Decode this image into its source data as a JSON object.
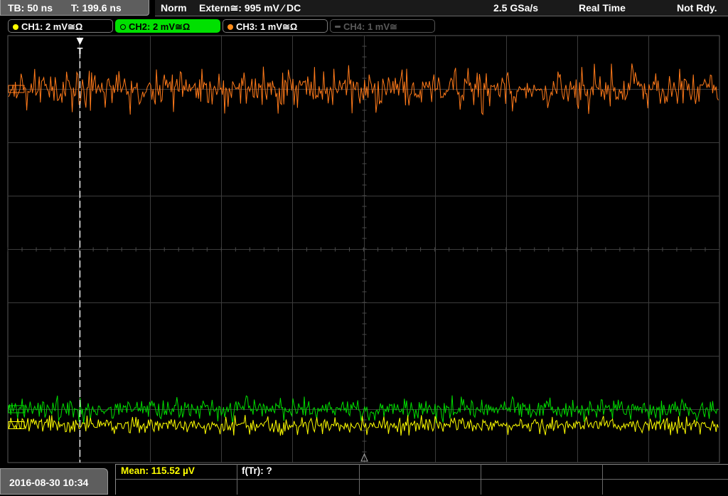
{
  "top_bar": {
    "timebase": "TB: 50 ns",
    "trigger_time": "T: 199.6 ns",
    "trigger_mode": "Norm",
    "trigger_source": "Extern≅: 995 mV ⁄ DC",
    "sample_rate": "2.5 GSa/s",
    "acquisition_mode": "Real Time",
    "status": "Not Rdy."
  },
  "channels": [
    {
      "label": "CH1: 2 mV≅Ω",
      "color": "#ffff00",
      "state": "on"
    },
    {
      "label": "CH2: 2 mV≅Ω",
      "color": "#00e000",
      "state": "selected"
    },
    {
      "label": "CH3: 1 mV≅Ω",
      "color": "#ff8c1a",
      "state": "on"
    },
    {
      "label": "CH4: 1 mV≅",
      "color": "#5a5a5a",
      "state": "off"
    }
  ],
  "trigger_marker": "T",
  "traces": [
    {
      "channel": "CH3",
      "color": "#ff7a1a",
      "level_div": 1.0,
      "noise_div": 0.32
    },
    {
      "channel": "CH2",
      "color": "#00dd00",
      "level_div": 7.0,
      "noise_div": 0.18
    },
    {
      "channel": "CH1",
      "color": "#ffff00",
      "level_div": 7.3,
      "noise_div": 0.13
    }
  ],
  "bottom_bar": {
    "datetime": "2016-08-30 10:34",
    "measurement_mean": "Mean: 115.52 µV",
    "measurement_freq": "f(Tr): ?"
  },
  "colors": {
    "grid": "#3c3c3c",
    "grid_center": "#4a4a4a",
    "trigger_line": "#ffffff",
    "selected_tab": "#00e000",
    "measure_text": "#ffff00"
  }
}
